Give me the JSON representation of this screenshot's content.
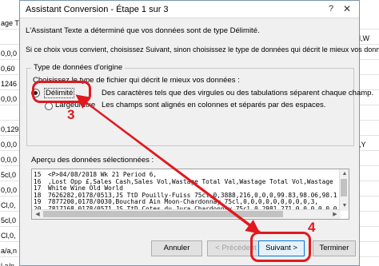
{
  "spreadsheet": {
    "left_cells": [
      "age T",
      "",
      "0,0,0",
      "0,60",
      "1246",
      "0,0,0",
      "",
      "0,129",
      "0,0,0",
      "0,0,0",
      "5cl,0",
      "0,0,0",
      "Cl,0,",
      "5cl,0",
      "Cl,0,",
      "a/a,n",
      "l,a/n"
    ],
    "right_cells": [
      "",
      "l,W",
      "",
      "",
      "",
      "",
      "",
      "",
      ",Y",
      "",
      "",
      "",
      "",
      "",
      "",
      "",
      ""
    ]
  },
  "dialog": {
    "title": "Assistant Conversion - Étape 1 sur 3",
    "help_glyph": "?",
    "close_glyph": "✕",
    "intro_line1": "L'Assistant Texte a déterminé que vos données sont de type Délimité.",
    "intro_line2": "Si ce choix vous convient, choisissez Suivant, sinon choisissez le type de données qui décrit le mieux vos données.",
    "group_title": "Type de données d'origine",
    "group_prompt": "Choisissez le type de fichier qui décrit le mieux vos données :",
    "options": [
      {
        "label": "Délimité",
        "description": "Des caractères tels que des virgules ou des tabulations séparent chaque champ.",
        "selected": true
      },
      {
        "label": "Largeur fixe",
        "description": "Les champs sont alignés en colonnes et séparés par des espaces.",
        "selected": false
      }
    ],
    "preview_label": "Aperçu des données sélectionnées :",
    "preview_rows": [
      {
        "num": "15",
        "text": "<P>04/08/2018 Wk 21 Period 6,"
      },
      {
        "num": "16",
        "text": ",Lost Opp £,Sales Cash,Sales Vol,Wastage Total Val,Wastage Total Vol,Wastage"
      },
      {
        "num": "17",
        "text": "White Wine Old World"
      },
      {
        "num": "18",
        "text": "7626282,0178/0513,JS TtD Pouilly-Fuiss 75cl,0,3888,216,0,0,0,99.83,98.06,98.1"
      },
      {
        "num": "19",
        "text": "7877200,0178/0030,Bouchard Ain Moon-Chardonnay 75cl,0,0,0,0,0,0,0,0,0,3,"
      },
      {
        "num": "20",
        "text": "7817168,0178/0571,JS TtD Cotes du Jura Chardonnay 75cl,0,2981.271,0,0,0,0,0,0,0"
      }
    ],
    "buttons": {
      "cancel": "Annuler",
      "previous": "< Précédent",
      "next": "Suivant >",
      "finish": "Terminer"
    }
  },
  "annotations": {
    "step3": "3",
    "step4": "4",
    "color": "#e0191f"
  }
}
